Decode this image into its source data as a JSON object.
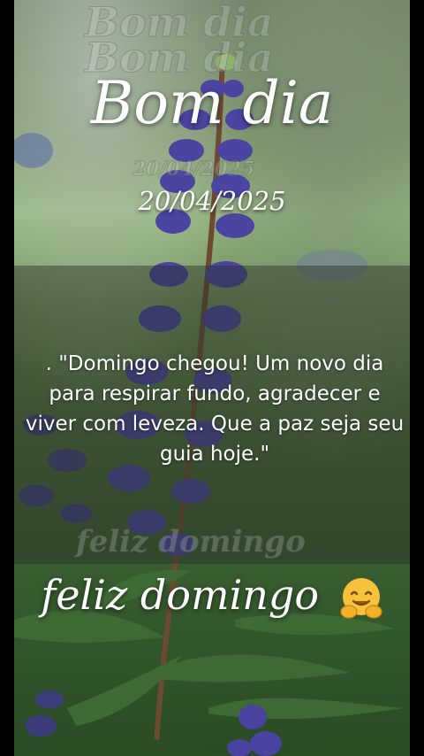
{
  "card": {
    "watermark_top": "Bom dia",
    "watermark_date": "20/04/2025",
    "watermark_footer": "feliz domingo",
    "title": "Bom dia",
    "date": "20/04/2025",
    "quote": ". \"Domingo chegou! Um novo dia para respirar fundo, agradecer e viver com leveza. Que a paz seja seu guia hoje.\"",
    "footer": "feliz domingo",
    "emoji_icon": "hugging-face-icon"
  },
  "colors": {
    "text": "#ffffff",
    "band": "#283028",
    "flower": "#5a4fa6",
    "leaf": "#3f6b35"
  }
}
